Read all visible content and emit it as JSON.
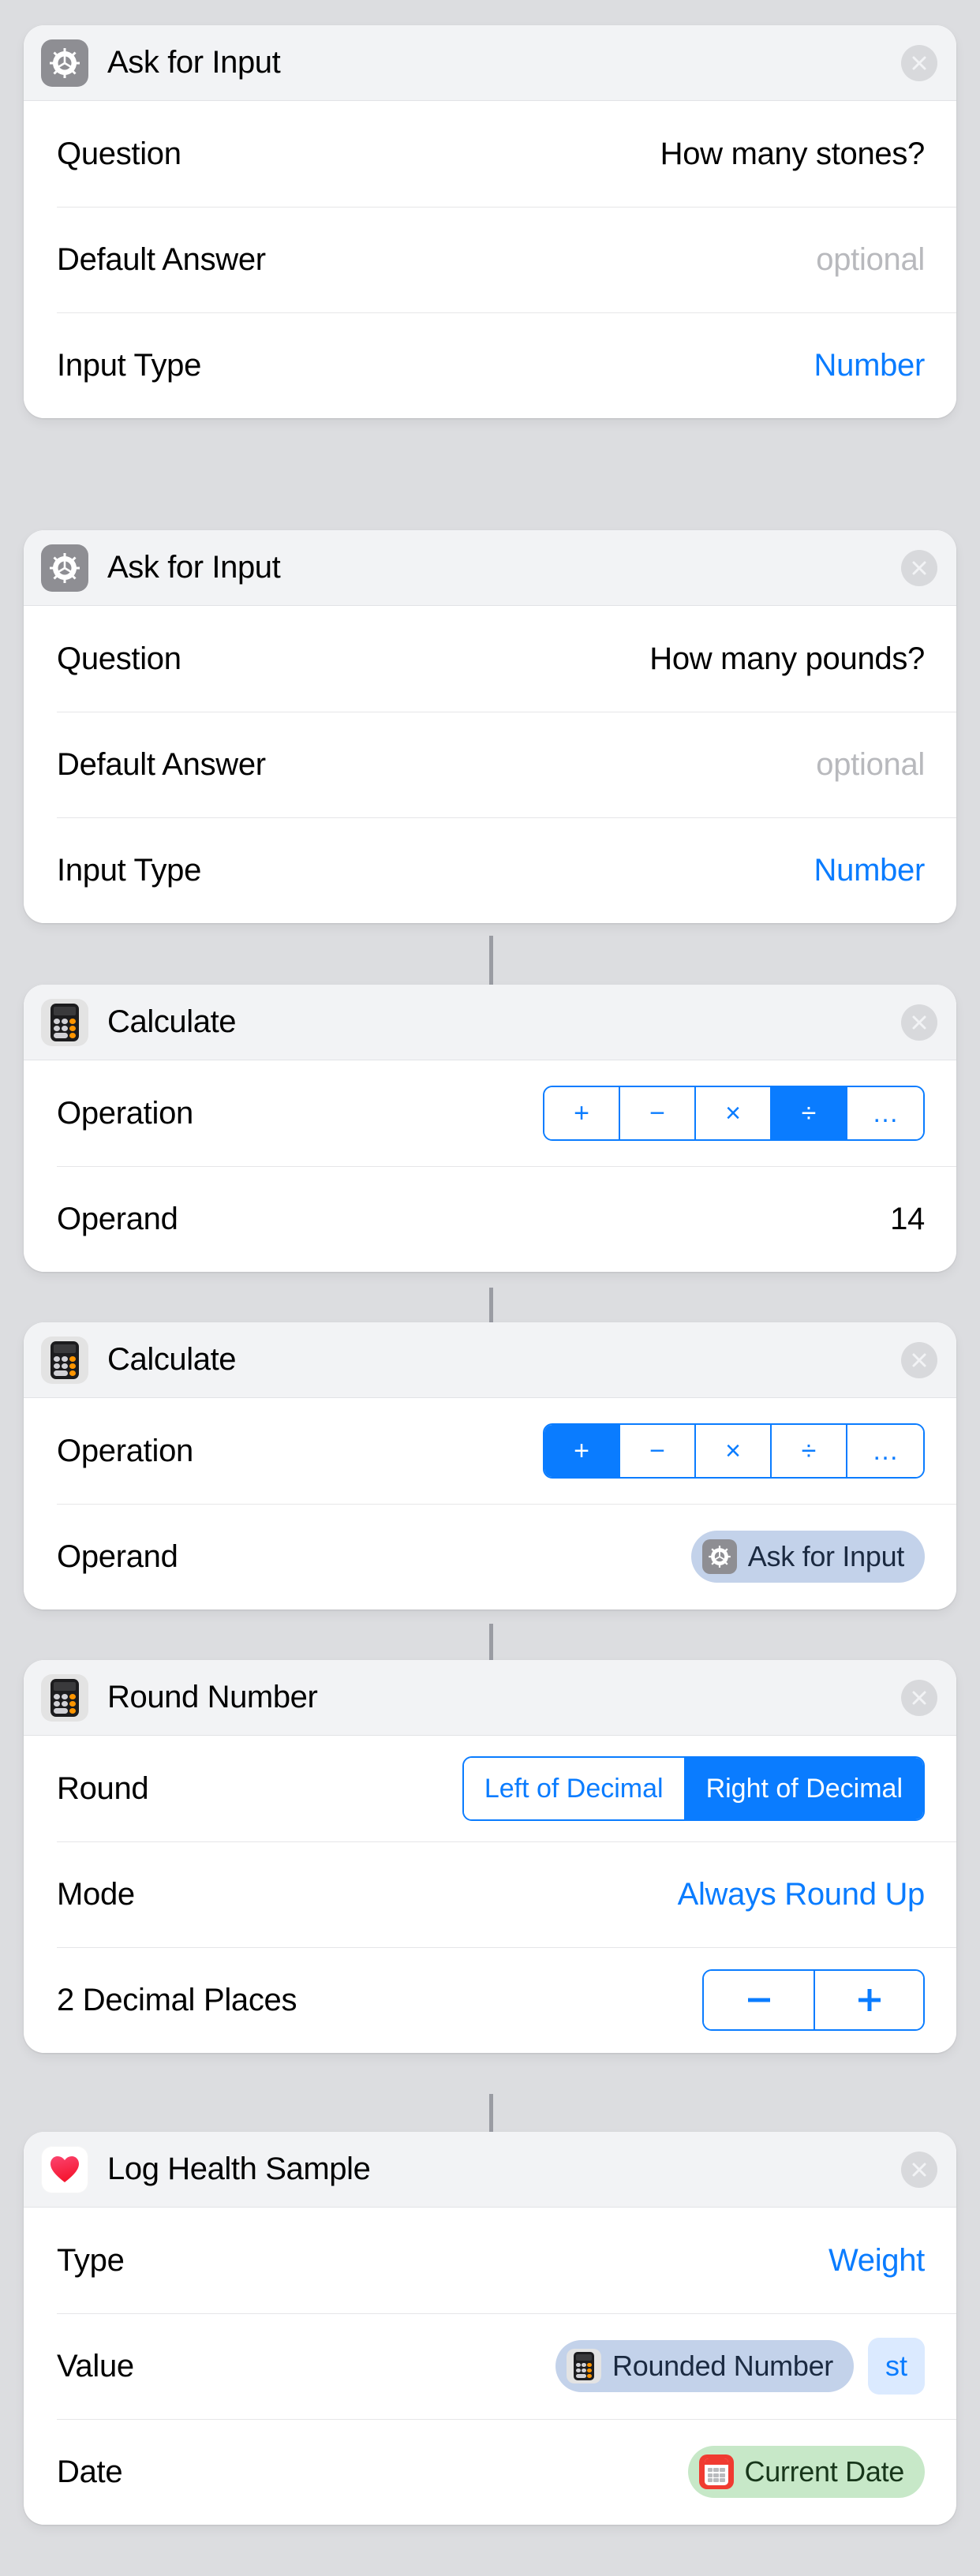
{
  "theme": {
    "accent_blue": "#0a7cff",
    "page_background": "#dcdde0",
    "card_background": "#ffffff",
    "card_header_background": "#f2f3f5",
    "muted_text": "#b8b9bd",
    "token_blue_background": "#c3d2ea",
    "token_green_background": "#c7e8c8",
    "unit_badge_background": "#dbeaff",
    "health_heart": "#f5325b"
  },
  "cards": [
    {
      "title": "Ask for Input",
      "icon": "gear-icon",
      "close_label": "×",
      "rows": [
        {
          "label": "Question",
          "value": "How many stones?",
          "style": "plain"
        },
        {
          "label": "Default Answer",
          "value": "optional",
          "style": "muted"
        },
        {
          "label": "Input Type",
          "value": "Number",
          "style": "blue"
        }
      ]
    },
    {
      "title": "Ask for Input",
      "icon": "gear-icon",
      "close_label": "×",
      "rows": [
        {
          "label": "Question",
          "value": "How many pounds?",
          "style": "plain"
        },
        {
          "label": "Default Answer",
          "value": "optional",
          "style": "muted"
        },
        {
          "label": "Input Type",
          "value": "Number",
          "style": "blue"
        }
      ]
    },
    {
      "title": "Calculate",
      "icon": "calculator-icon",
      "close_label": "×",
      "rows": [
        {
          "label": "Operation",
          "style": "segmented",
          "segments": [
            "+",
            "−",
            "×",
            "÷",
            "…"
          ],
          "selected_index": 3
        },
        {
          "label": "Operand",
          "value": "14",
          "style": "plain"
        }
      ]
    },
    {
      "title": "Calculate",
      "icon": "calculator-icon",
      "close_label": "×",
      "rows": [
        {
          "label": "Operation",
          "style": "segmented",
          "segments": [
            "+",
            "−",
            "×",
            "÷",
            "…"
          ],
          "selected_index": 0
        },
        {
          "label": "Operand",
          "style": "token",
          "token": {
            "text": "Ask for Input",
            "icon": "gear-icon",
            "color": "blue"
          }
        }
      ]
    },
    {
      "title": "Round Number",
      "icon": "calculator-icon",
      "close_label": "×",
      "rows": [
        {
          "label": "Round",
          "style": "segmented-wide",
          "segments": [
            "Left of Decimal",
            "Right of Decimal"
          ],
          "selected_index": 1
        },
        {
          "label": "Mode",
          "value": "Always Round Up",
          "style": "blue"
        },
        {
          "label": "2 Decimal Places",
          "style": "stepper",
          "stepper": {
            "decrement_label": "−",
            "increment_label": "+"
          }
        }
      ]
    },
    {
      "title": "Log Health Sample",
      "icon": "health-heart-icon",
      "close_label": "×",
      "rows": [
        {
          "label": "Type",
          "value": "Weight",
          "style": "blue"
        },
        {
          "label": "Value",
          "style": "token-unit",
          "token": {
            "text": "Rounded Number",
            "icon": "calculator-icon",
            "color": "blue"
          },
          "unit": "st"
        },
        {
          "label": "Date",
          "style": "token",
          "token": {
            "text": "Current Date",
            "icon": "calendar-icon",
            "color": "green"
          }
        }
      ]
    }
  ]
}
